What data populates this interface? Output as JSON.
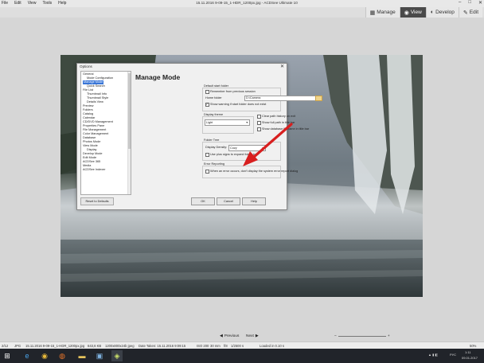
{
  "menu": [
    "File",
    "Edit",
    "View",
    "Tools",
    "Help"
  ],
  "window_title": "15.11.2016 9-09-15_1-HDR_1200px.jpg - ACDSee Ultimate 10",
  "modes": [
    {
      "label": "Manage",
      "icon": "manage-icon"
    },
    {
      "label": "View",
      "icon": "view-icon",
      "active": true
    },
    {
      "label": "Develop",
      "icon": "develop-icon"
    },
    {
      "label": "Edit",
      "icon": "edit-icon"
    }
  ],
  "dialog": {
    "title": "Options",
    "heading": "Manage Mode",
    "tree": [
      "General",
      "Mode Configuration",
      "Manage Mode",
      "Quick Search",
      "File List",
      "Thumbnail Info",
      "Thumbnail Style",
      "Details View",
      "Preview",
      "Folders",
      "Catalog",
      "Calendar",
      "CD/DVD Management",
      "Properties Pane",
      "File Management",
      "Color Management",
      "Database",
      "Photos Mode",
      "View Mode",
      "Display",
      "Develop Mode",
      "Edit Mode",
      "ACDSee 365",
      "Media",
      "ACDSee Indexer"
    ],
    "default_start_folder": {
      "label": "Default start folder",
      "remember": "Remember from previous session",
      "home_folder_label": "Home folder",
      "home_folder_value": "D:\\Camera",
      "show_warning": "Show warning if start folder does not exist"
    },
    "display_theme": {
      "label": "Display theme",
      "value": "Light"
    },
    "options_right": [
      {
        "label": "Clear path history on exit",
        "checked": false
      },
      {
        "label": "Show full path in title bar",
        "checked": false
      },
      {
        "label": "Show database filename in title bar",
        "checked": false
      }
    ],
    "folder_tree": {
      "label": "Folder Tree",
      "display_density_label": "Display Density:",
      "display_density_value": "Cozy",
      "plus_signs": "Use plus signs to expand folder tree"
    },
    "error_reporting": {
      "label": "Error Reporting",
      "text": "When an error occurs, don't display the system error report dialog"
    },
    "buttons": {
      "reset": "Reset to Defaults",
      "ok": "OK",
      "cancel": "Cancel",
      "help": "Help"
    }
  },
  "navigation": {
    "previous": "Previous",
    "next": "Next"
  },
  "status": {
    "position": "2/12",
    "file_type": "JPG",
    "filename": "15.11.2016 9-09-15_1-HDR_1200px.jpg",
    "size": "643,6 KB",
    "dimensions": "1200x800x24b jpeg",
    "date_taken": "Date Taken: 15.11.2016 9:09:15",
    "iso": "ISO 200",
    "focal": "30 mm",
    "aperture": "f/8",
    "shutter": "1/2500 s",
    "loaded": "Loaded in 0.10 s",
    "zoom": "50%"
  },
  "taskbar": {
    "apps": [
      "windows-logo-icon",
      "ie-icon",
      "chrome-icon",
      "firefox-icon",
      "explorer-icon",
      "monitor-icon",
      "acdsee-icon"
    ],
    "language": "РУС",
    "time": "1:11",
    "date": "09.01.2017"
  },
  "colors": {
    "accent": "#3875d7",
    "mode_active": "#4a4a4a",
    "arrow": "#d81f1f"
  }
}
